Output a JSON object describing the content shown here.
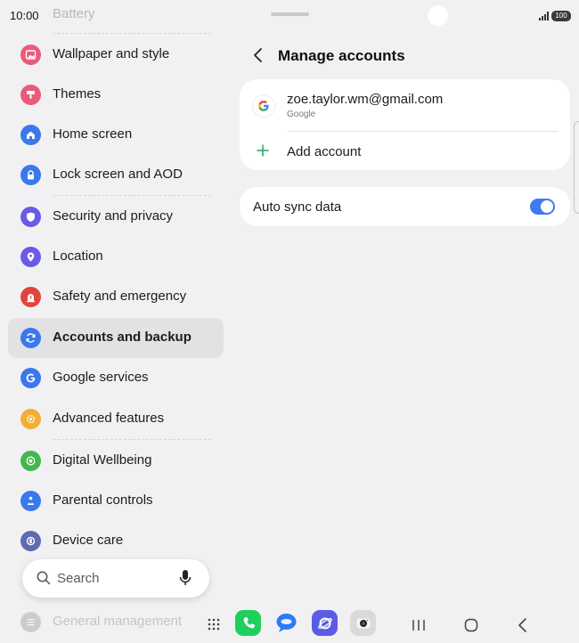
{
  "status_bar": {
    "time": "10:00",
    "battery": "100"
  },
  "sidebar": {
    "faded_top_label": "Battery",
    "items": [
      {
        "label": "Wallpaper and style",
        "icon": "wallpaper-icon",
        "color": "#ea5a7a"
      },
      {
        "label": "Themes",
        "icon": "themes-icon",
        "color": "#ea5a7a"
      },
      {
        "label": "Home screen",
        "icon": "home-icon",
        "color": "#3a78ec"
      },
      {
        "label": "Lock screen and AOD",
        "icon": "lock-icon",
        "color": "#3a78ec"
      },
      {
        "label": "Security and privacy",
        "icon": "shield-icon",
        "color": "#6a5be6"
      },
      {
        "label": "Location",
        "icon": "location-pin-icon",
        "color": "#6a5be6"
      },
      {
        "label": "Safety and emergency",
        "icon": "emergency-icon",
        "color": "#e0453c"
      },
      {
        "label": "Accounts and backup",
        "icon": "sync-icon",
        "color": "#3a78ec"
      },
      {
        "label": "Google services",
        "icon": "google-g-icon",
        "color": "#3a78ec"
      },
      {
        "label": "Advanced features",
        "icon": "gear-star-icon",
        "color": "#f4ad36"
      },
      {
        "label": "Digital Wellbeing",
        "icon": "wellbeing-icon",
        "color": "#41b84c"
      },
      {
        "label": "Parental controls",
        "icon": "parental-icon",
        "color": "#3a78ec"
      },
      {
        "label": "Device care",
        "icon": "device-care-icon",
        "color": "#5e6bb0"
      },
      {
        "label": "General management",
        "icon": "general-management-icon",
        "color": "#8a8a8e"
      }
    ],
    "selected_index": 7
  },
  "search": {
    "placeholder": "Search"
  },
  "header": {
    "title": "Manage accounts"
  },
  "account": {
    "email": "zoe.taylor.wm@gmail.com",
    "type": "Google"
  },
  "add_account": {
    "label": "Add account"
  },
  "auto_sync": {
    "label": "Auto sync data",
    "enabled": true
  },
  "colors": {
    "accent": "#3e7bf0",
    "add_plus": "#2faa6b"
  }
}
